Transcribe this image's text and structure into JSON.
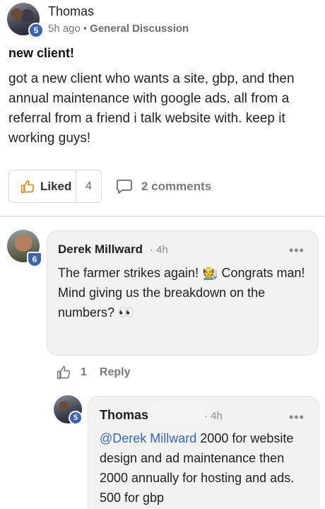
{
  "post": {
    "author": "Thomas",
    "level": "5",
    "time_ago": "5h ago",
    "separator": "•",
    "category": "General Discussion",
    "title": "new client!",
    "body": "got a new client who wants a site, gbp, and then annual maintenance with google ads. all from a referral from a friend i talk website with. keep it working guys!"
  },
  "actions": {
    "like_label": "Liked",
    "like_count": "4",
    "comments_label": "2 comments"
  },
  "comment": {
    "author": "Derek Millward",
    "level": "6",
    "time": "· 4h",
    "line1": "The farmer strikes again! 🧑‍🌾 Congrats man!",
    "line2": "Mind giving us the breakdown on the numbers? 👀",
    "like_count": "1",
    "reply_label": "Reply",
    "more": "•••"
  },
  "reply": {
    "author": "Thomas",
    "level": "5",
    "time": "· 4h",
    "mention": "@Derek Millward",
    "text": " 2000 for website design and ad maintenance then 2000 annually for hosting and ads. 500 for gbp",
    "more": "•••"
  },
  "colors": {
    "accent": "#3a64b0",
    "mention": "#3568c0"
  }
}
